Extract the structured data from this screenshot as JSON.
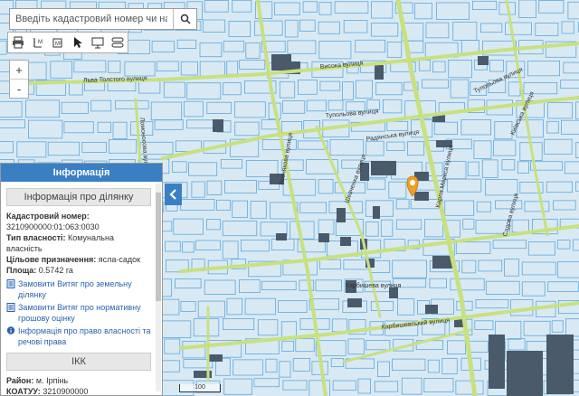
{
  "search": {
    "placeholder": "Введіть кадастровий номер чи населений"
  },
  "toolbar": {
    "tools": [
      "print-icon",
      "measure-length-icon",
      "measure-area-icon",
      "pointer-icon",
      "screen-icon",
      "route-icon"
    ]
  },
  "zoom": {
    "in_label": "+",
    "out_label": "-"
  },
  "map": {
    "street_labels": {
      "tolstogo": "Льва Толстого вулиця",
      "vysoka": "Висока вулиця",
      "tupolieva": "Тупольова вулиця",
      "tupolieva_east": "Тупольова вулиця",
      "radianska": "Радянська вулиця",
      "vozniakova": "Вознякова вулиця",
      "kyivska": "Київська вулиця",
      "shevchenka": "Шевченка вулиця",
      "karla_marksa": "Карла Маркса вулиця",
      "sadova": "Садова вулиця",
      "karbyshieva": "Карбишева вулиця",
      "park": "Карбишевський вулиця",
      "lomonosova": "Ломоносова вулиця"
    },
    "marker_color": "#f0a020",
    "parcel_color": "#5ea8dc",
    "road_color": "#c8e080",
    "scale_label": "100"
  },
  "info_panel": {
    "header": "Інформація",
    "section1_title": "Інформація про ділянку",
    "cadastral_label": "Кадастровий номер:",
    "cadastral_value": "3210900000:01:063:0030",
    "ownership_label": "Тип власності:",
    "ownership_value": "Комунальна власність",
    "purpose_label": "Цільове призначення:",
    "purpose_value": "ясла-садок",
    "area_label": "Площа:",
    "area_value": "0.5742 га",
    "link1": "Замовити Витяг про земельну ділянку",
    "link2": "Замовити Витяг про нормативну грошову оцінку",
    "link3": "Інформація про право власності та речові права",
    "section2_title": "ІКК",
    "district_label": "Район:",
    "district_value": "м. Ірпінь",
    "koatuu_label": "КОАТУУ:",
    "koatuu_value": "3210900000"
  }
}
